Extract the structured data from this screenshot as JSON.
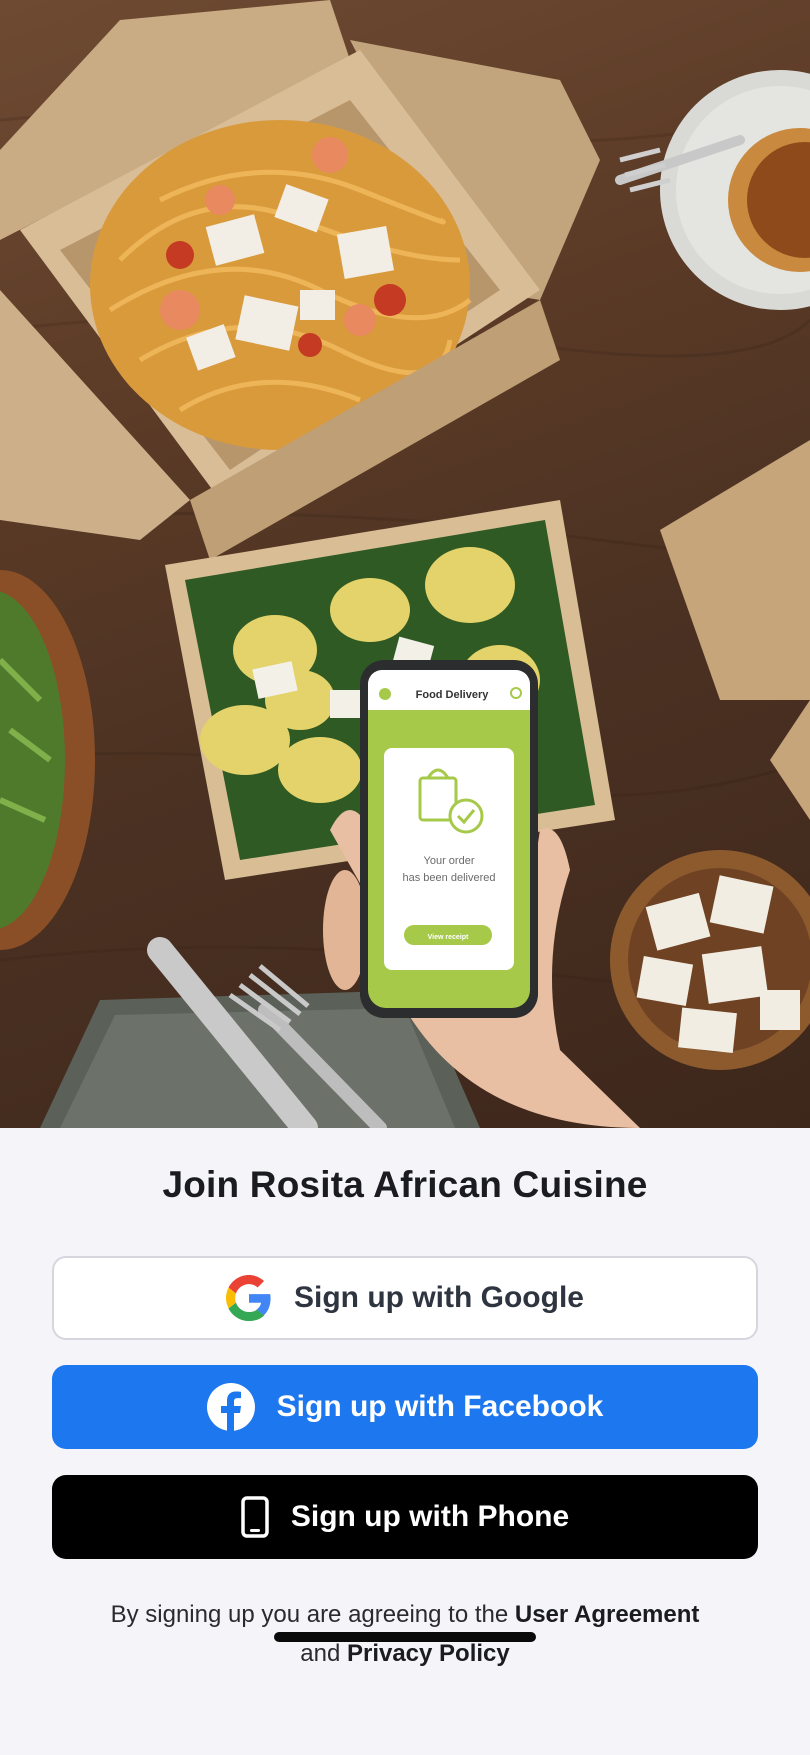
{
  "hero": {
    "phone_screen": {
      "header_title": "Food Delivery",
      "message_line1": "Your order",
      "message_line2": "has been delivered",
      "button_label": "View receipt"
    }
  },
  "signup": {
    "title": "Join Rosita African Cuisine",
    "google_label": "Sign up with Google",
    "facebook_label": "Sign up with Facebook",
    "phone_label": "Sign up with Phone",
    "legal_prefix": "By signing up you are agreeing to the",
    "user_agreement_link": "User Agreement",
    "legal_and": "and",
    "privacy_policy_link": "Privacy Policy"
  },
  "colors": {
    "facebook_blue": "#1d77ef",
    "phone_black": "#000000",
    "google_border": "#d6d6de",
    "sheet_background": "#f4f4f9",
    "app_accent_green": "#a6c94a"
  },
  "icons": {
    "google": "google-icon",
    "facebook": "facebook-icon",
    "phone": "smartphone-icon"
  }
}
